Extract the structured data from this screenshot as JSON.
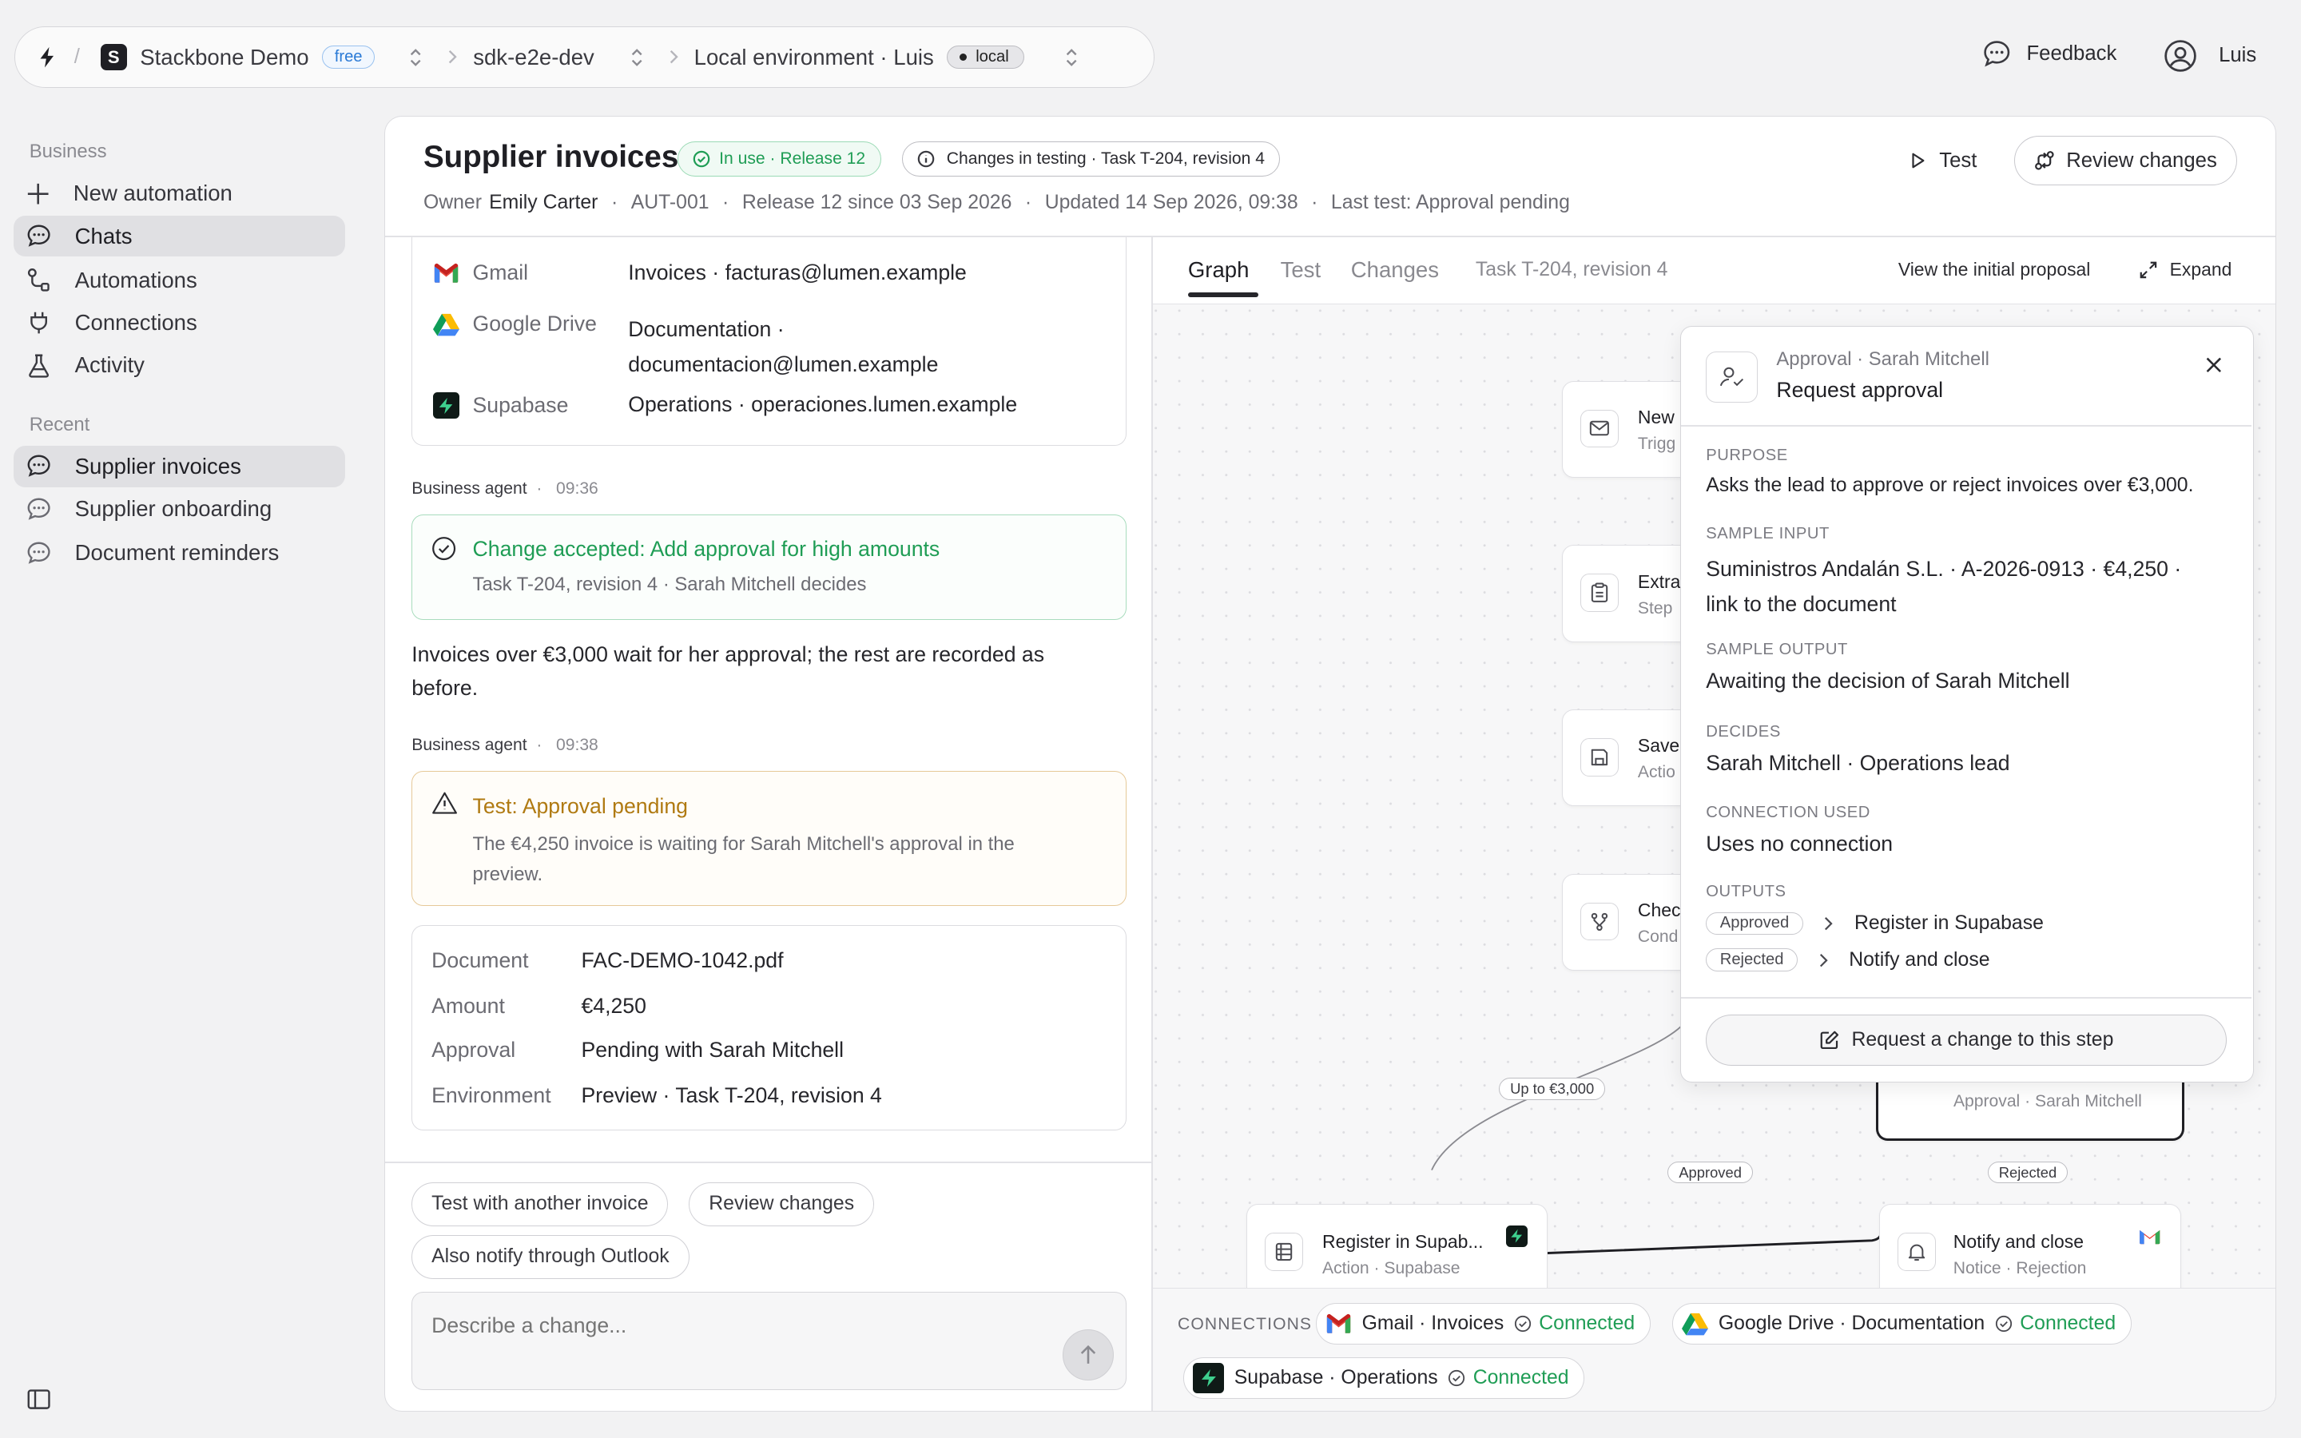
{
  "topbar": {
    "org_name": "Stackbone Demo",
    "plan_badge": "free",
    "project": "sdk-e2e-dev",
    "environment": "Local environment · Luis",
    "env_badge": "local",
    "feedback": "Feedback",
    "user": "Luis"
  },
  "sidebar": {
    "section_business": "Business",
    "items": [
      {
        "label": "New automation",
        "icon": "plus-icon"
      },
      {
        "label": "Chats",
        "icon": "chat-bubble-icon"
      },
      {
        "label": "Automations",
        "icon": "flow-icon"
      },
      {
        "label": "Connections",
        "icon": "plug-icon"
      },
      {
        "label": "Activity",
        "icon": "flask-icon"
      }
    ],
    "section_recent": "Recent",
    "recent": [
      {
        "label": "Supplier invoices"
      },
      {
        "label": "Supplier onboarding"
      },
      {
        "label": "Document reminders"
      }
    ]
  },
  "header": {
    "title": "Supplier invoices",
    "status_badge": "In use · Release 12",
    "changes_badge": "Changes in testing · Task T-204, revision 4",
    "owner_label": "Owner",
    "owner_name": "Emily Carter",
    "id": "AUT-001",
    "release": "Release 12 since 03 Sep 2026",
    "updated": "Updated 14 Sep 2026, 09:38",
    "last_test": "Last test: Approval pending",
    "test_button": "Test",
    "review_button": "Review changes"
  },
  "chat": {
    "sources": [
      {
        "service": "Gmail",
        "value": "Invoices · facturas@lumen.example"
      },
      {
        "service": "Google Drive",
        "value_line1": "Documentation ·",
        "value_line2": "documentacion@lumen.example"
      },
      {
        "service": "Supabase",
        "value": "Operations · operaciones.lumen.example"
      }
    ],
    "msg1_agent": "Business agent",
    "msg1_time": "09:36",
    "accepted_title": "Change accepted: Add approval for high amounts",
    "accepted_sub": "Task T-204, revision 4 · Sarah Mitchell decides",
    "msg1_text": "Invoices over €3,000 wait for her approval; the rest are recorded as before.",
    "msg2_agent": "Business agent",
    "msg2_time": "09:38",
    "pending_title": "Test: Approval pending",
    "pending_text": "The €4,250 invoice is waiting for Sarah Mitchell's approval in the preview.",
    "details": [
      {
        "label": "Document",
        "value": "FAC-DEMO-1042.pdf"
      },
      {
        "label": "Amount",
        "value": "€4,250"
      },
      {
        "label": "Approval",
        "value": "Pending with Sarah Mitchell"
      },
      {
        "label": "Environment",
        "value": "Preview · Task T-204, revision 4"
      }
    ],
    "suggestions": [
      "Test with another invoice",
      "Review changes",
      "Also notify through Outlook"
    ],
    "composer_placeholder": "Describe a change..."
  },
  "graph": {
    "tabs": [
      "Graph",
      "Test",
      "Changes"
    ],
    "tab_context": "Task T-204, revision 4",
    "view_initial": "View the initial proposal",
    "expand": "Expand",
    "nodes": [
      {
        "title": "New",
        "sub": "Trigg"
      },
      {
        "title": "Extra",
        "sub": "Step"
      },
      {
        "title": "Save",
        "sub": "Actio"
      },
      {
        "title": "Chec",
        "sub": "Cond"
      }
    ],
    "approval_node_sub": "Approval · Sarah Mitchell",
    "register_title": "Register in Supab...",
    "register_sub": "Action · Supabase",
    "notify_title": "Notify and close",
    "notify_sub": "Notice · Rejection",
    "edge_up_to": "Up to €3,000",
    "edge_approved": "Approved",
    "edge_rejected": "Rejected"
  },
  "panel": {
    "kicker": "Approval · Sarah Mitchell",
    "title": "Request approval",
    "purpose_h": "PURPOSE",
    "purpose": "Asks the lead to approve or reject invoices over €3,000.",
    "input_h": "SAMPLE INPUT",
    "input_l1": "Suministros Andalán S.L. · A-2026-0913 · €4,250 ·",
    "input_l2": "link to the document",
    "output_h": "SAMPLE OUTPUT",
    "output": "Awaiting the decision of Sarah Mitchell",
    "decides_h": "DECIDES",
    "decides": "Sarah Mitchell · Operations lead",
    "conn_h": "CONNECTION USED",
    "conn": "Uses no connection",
    "outputs_h": "OUTPUTS",
    "outputs": [
      {
        "chip": "Approved",
        "target": "Register in Supabase"
      },
      {
        "chip": "Rejected",
        "target": "Notify and close"
      }
    ],
    "request_change": "Request a change to this step"
  },
  "connections": {
    "label": "CONNECTIONS",
    "items": [
      {
        "name": "Gmail · Invoices",
        "status": "Connected"
      },
      {
        "name": "Google Drive · Documentation",
        "status": "Connected"
      },
      {
        "name": "Supabase · Operations",
        "status": "Connected"
      }
    ]
  }
}
